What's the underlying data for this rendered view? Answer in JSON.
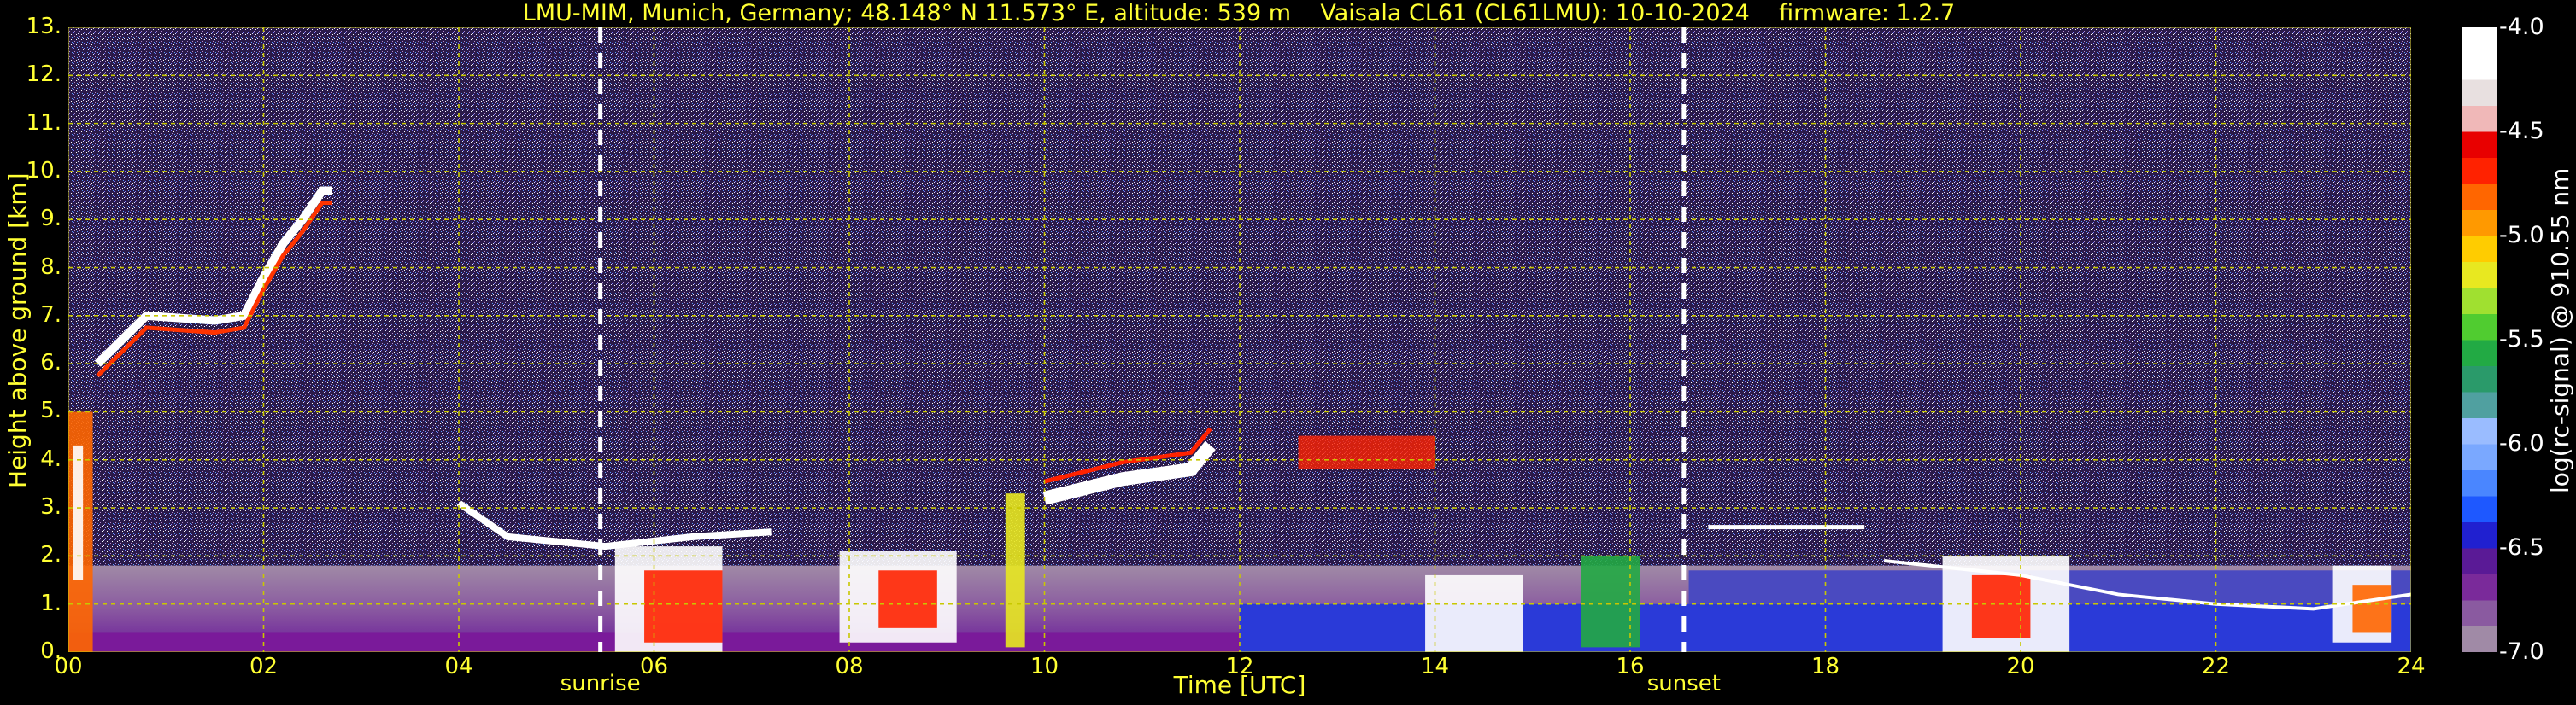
{
  "title": "LMU-MIM, Munich, Germany; 48.148° N 11.573° E, altitude: 539 m    Vaisala CL61 (CL61LMU): 10-10-2024    firmware: 1.2.7",
  "chart_data": {
    "type": "heatmap",
    "title": "LMU-MIM, Munich, Germany; 48.148° N 11.573° E, altitude: 539 m    Vaisala CL61 (CL61LMU): 10-10-2024    firmware: 1.2.7",
    "xlabel": "Time [UTC]",
    "ylabel": "Height above ground [km]",
    "xlim": [
      0,
      24
    ],
    "ylim": [
      0,
      13
    ],
    "x_ticks": [
      "00",
      "02",
      "04",
      "06",
      "08",
      "10",
      "12",
      "14",
      "16",
      "18",
      "20",
      "22",
      "24"
    ],
    "y_ticks": [
      "0.",
      "1.",
      "2.",
      "3.",
      "4.",
      "5.",
      "6.",
      "7.",
      "8.",
      "9.",
      "10.",
      "11.",
      "12.",
      "13."
    ],
    "grid": true,
    "annotations": [
      {
        "text": "sunrise",
        "x": 5.45
      },
      {
        "text": "sunset",
        "x": 16.55
      }
    ],
    "colorbar": {
      "label": "log(rc-signal) @ 910.55 nm",
      "range": [
        -7.0,
        -4.0
      ],
      "ticks": [
        "-4.0",
        "-4.5",
        "-5.0",
        "-5.5",
        "-6.0",
        "-6.5",
        "-7.0"
      ],
      "colors": [
        "#a08aa6",
        "#8a5aa0",
        "#7a2a9a",
        "#5a1a96",
        "#2020d0",
        "#1e58ff",
        "#4a86ff",
        "#7aa8ff",
        "#9abcff",
        "#50a0a0",
        "#2a9a6a",
        "#22aa44",
        "#50cc30",
        "#a0e030",
        "#e8e820",
        "#ffcc00",
        "#ff9900",
        "#ff6600",
        "#ff2200",
        "#e80000",
        "#f0b8b8",
        "#e8e0e0",
        "#ffffff",
        "#ffffff"
      ]
    }
  },
  "colors": {
    "text": "#ffff33",
    "grid": "#c8c800",
    "sun_line": "#ffffff",
    "background": "#000000"
  }
}
